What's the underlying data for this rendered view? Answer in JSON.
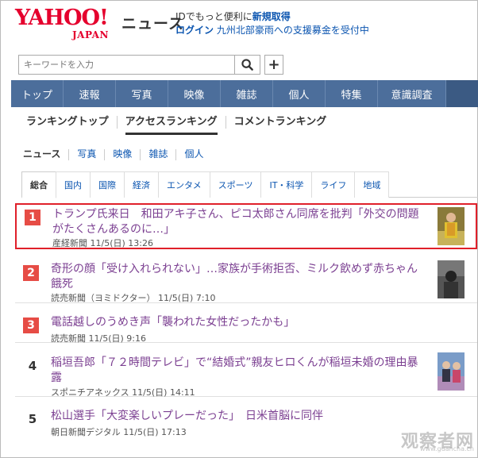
{
  "header": {
    "logo_main": "YAHOO!",
    "logo_sub": "JAPAN",
    "logo_news": "ニュース",
    "promo_line1_pre": "IDでもっと便利に",
    "promo_line1_link": "新規取得",
    "promo_line2_login": "ログイン",
    "promo_line2_text": "九州北部豪雨への支援募金を受付中"
  },
  "search": {
    "placeholder": "キーワードを入力",
    "search_icon": "search-icon",
    "plus_label": "+"
  },
  "nav": {
    "items": [
      "トップ",
      "速報",
      "写真",
      "映像",
      "雑誌",
      "個人",
      "特集",
      "意識調査"
    ]
  },
  "ranking_tabs": {
    "items": [
      "ランキングトップ",
      "アクセスランキング",
      "コメントランキング"
    ],
    "active_index": 1
  },
  "category_tabs": {
    "items": [
      "ニュース",
      "写真",
      "映像",
      "雑誌",
      "個人"
    ],
    "active_index": 0
  },
  "genre_tabs": {
    "items": [
      "総合",
      "国内",
      "国際",
      "経済",
      "エンタメ",
      "スポーツ",
      "IT・科学",
      "ライフ",
      "地域"
    ],
    "active_index": 0
  },
  "articles": [
    {
      "rank": "1",
      "title": "トランプ氏来日　和田アキ子さん、ピコ太郎さん同席を批判「外交の問題がたくさんあるのに…」",
      "source": "産経新聞 11/5(日) 13:26"
    },
    {
      "rank": "2",
      "title": "奇形の顔「受け入れられない」…家族が手術拒否、ミルク飲めず赤ちゃん餓死",
      "source": "読売新聞（ヨミドクター） 11/5(日) 7:10"
    },
    {
      "rank": "3",
      "title": "電話越しのうめき声「襲われた女性だったかも」",
      "source": "読売新聞 11/5(日) 9:16"
    },
    {
      "rank": "4",
      "title": "稲垣吾郎「７２時間テレビ」で“結婚式”親友ヒロくんが稲垣未婚の理由暴露",
      "source": "スポニチアネックス 11/5(日) 14:11"
    },
    {
      "rank": "5",
      "title": "松山選手「大変楽しいプレーだった」　日米首脳に同伴",
      "source": "朝日新聞デジタル 11/5(日) 17:13"
    }
  ],
  "watermark": {
    "text": "观察者网",
    "url": "www.guancha.cn"
  },
  "colors": {
    "yahoo_red": "#e5002d",
    "nav_blue": "#4c6e9b",
    "link_blue": "#0b55b0",
    "visited_purple": "#7b3f91",
    "rank_red": "#e64c45",
    "highlight_red": "#e0202a"
  }
}
